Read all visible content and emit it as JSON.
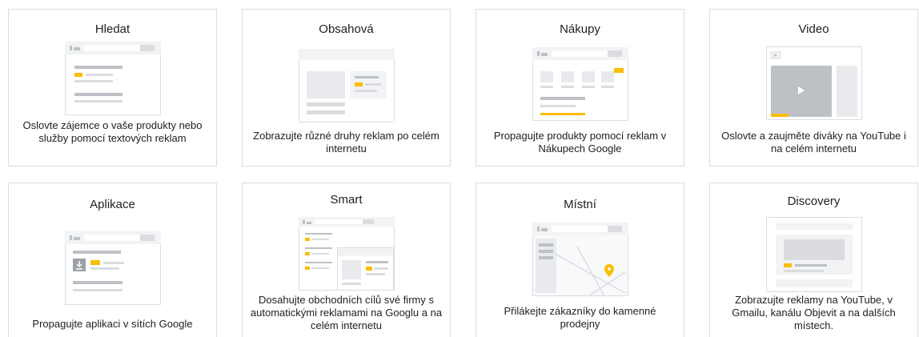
{
  "cards": [
    {
      "title": "Hledat",
      "description": "Oslovte zájemce o vaše produkty nebo služby pomocí textových reklam",
      "icon": "search-ads-illustration"
    },
    {
      "title": "Obsahová",
      "description": "Zobrazujte různé druhy reklam po celém internetu",
      "icon": "display-ads-illustration"
    },
    {
      "title": "Nákupy",
      "description": "Propagujte produkty pomocí reklam v Nákupech Google",
      "icon": "shopping-ads-illustration"
    },
    {
      "title": "Video",
      "description": "Oslovte a zaujměte diváky na YouTube i na celém internetu",
      "icon": "video-ads-illustration"
    },
    {
      "title": "Aplikace",
      "description": "Propagujte aplikaci v sítích Google",
      "icon": "app-ads-illustration"
    },
    {
      "title": "Smart",
      "description": "Dosahujte obchodních cílů své firmy s automatickými reklamami na Googlu a na celém internetu",
      "icon": "smart-ads-illustration"
    },
    {
      "title": "Místní",
      "description": "Přilákejte zákazníky do kamenné prodejny",
      "icon": "local-ads-illustration"
    },
    {
      "title": "Discovery",
      "description": "Zobrazujte reklamy na YouTube, v Gmailu, kanálu Objevit a na dalších místech.",
      "icon": "discovery-ads-illustration"
    }
  ],
  "colors": {
    "accent": "#fbbc04",
    "placeholder": "#dadce0",
    "border": "#dadce0"
  }
}
